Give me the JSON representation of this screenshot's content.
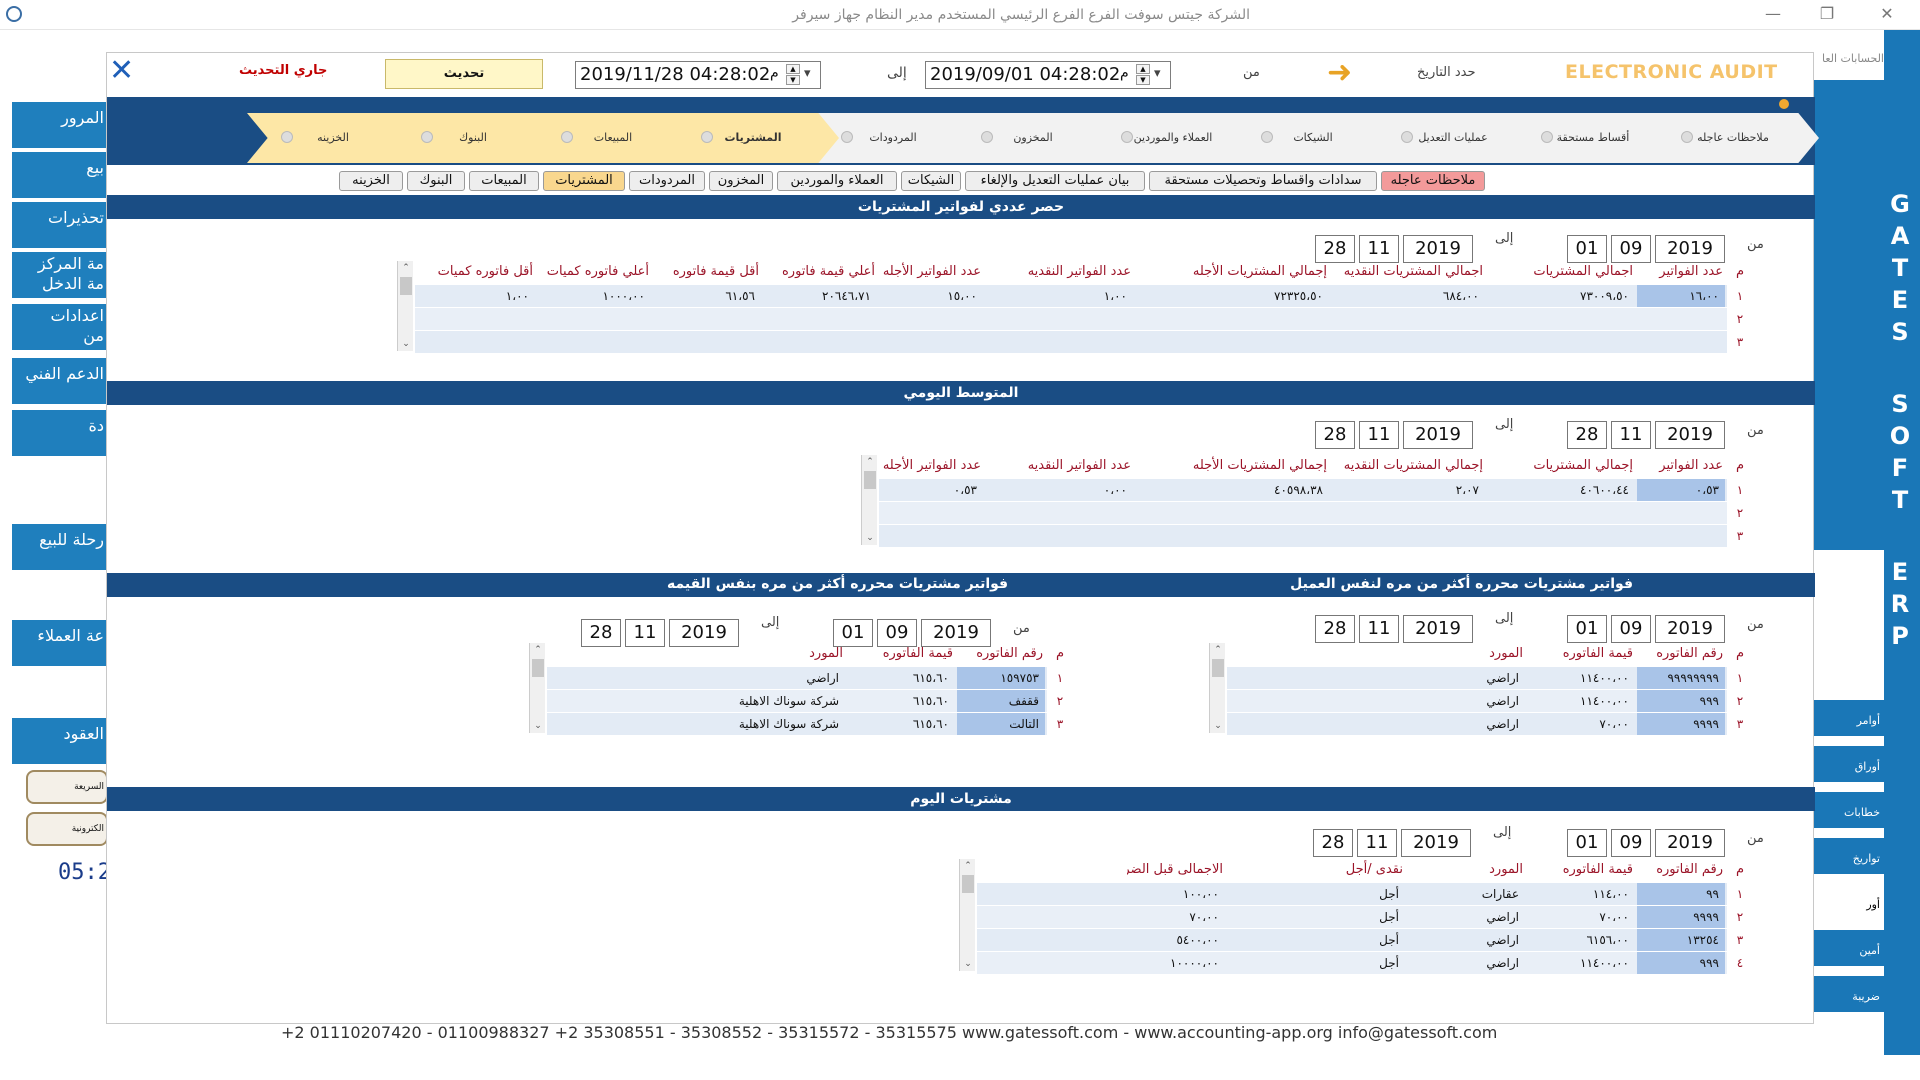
{
  "window": {
    "title": "الشركة جيتس سوفت   الفرع الفرع الرئيسي   المستخدم مدير النظام   جهاز سيرفر",
    "minimize": "—",
    "restore": "❐",
    "close": "✕"
  },
  "left_menu": [
    "المرور",
    "بيع",
    "تحذيرات",
    "مة المركز",
    "مة الدخل",
    "اعدادات",
    "من",
    "الدعم الفني",
    "دة",
    "رحلة للبيع",
    "عة العملاء",
    "العقود"
  ],
  "left_pills": [
    "السريعة",
    "الكترونية"
  ],
  "clock": "05:2",
  "right_menu": [
    "الحسابات العا",
    "أوامر",
    "أوراق",
    "خطابات",
    "تواريخ",
    "أور",
    "أمين",
    "ضريبة"
  ],
  "brand_letters": [
    "G",
    "A",
    "T",
    "E",
    "S",
    "",
    "S",
    "O",
    "F",
    "T",
    "",
    "E",
    "R",
    "P"
  ],
  "footer": "+2 01110207420 - 01100988327      +2 35308551 - 35308552 - 35315572 - 35315575      www.gatessoft.com  -  www.accounting-app.org      info@gatessoft.com",
  "toolbar": {
    "brand": "ELECTRONIC AUDIT",
    "date_range_label": "حدد التاريخ",
    "from_label": "من",
    "from_value": "2019/09/01 04:28:02",
    "to_label": "إلى",
    "to_value": "2019/11/28 04:28:02",
    "am_pm": "م",
    "refresh": "تحديث",
    "status": "جاري التحديث"
  },
  "steps": [
    "ملاحظات عاجله",
    "أقساط مستحقة",
    "عمليات التعديل",
    "الشيكات",
    "العملاء والموردين",
    "المخزون",
    "المردودات",
    "المشتريات",
    "المبيعات",
    "البنوك",
    "الخزينه"
  ],
  "tabs": [
    "ملاحظات عاجله",
    "سدادات واقساط وتحصيلات مستحقة",
    "بيان عمليات التعديل والإلغاء",
    "الشيكات",
    "العملاء والموردين",
    "المخزون",
    "المردودات",
    "المشتريات",
    "المبيعات",
    "البنوك",
    "الخزينه"
  ],
  "sections": {
    "count": {
      "title": "حصر عددي لفواتير المشتريات",
      "from": {
        "label": "من",
        "day": "01",
        "month": "09",
        "year": "2019"
      },
      "to": {
        "label": "إلى",
        "day": "28",
        "month": "11",
        "year": "2019"
      },
      "headers": [
        "م",
        "عدد الفواتير",
        "اجمالي المشتريات",
        "اجمالي المشتريات النقديه",
        "إجمالي المشتريات الأجله",
        "عدد الفواتير النقديه",
        "عدد الفواتير الأجله",
        "أعلي قيمة فاتوره",
        "أقل قيمة فاتوره",
        "أعلي فاتوره كميات",
        "أقل فاتوره كميات"
      ],
      "row_nums": [
        "١",
        "٢",
        "٣"
      ],
      "rows": [
        [
          "١٦،٠٠",
          "٧٣٠٠٩،٥٠",
          "٦٨٤،٠٠",
          "٧٢٣٢٥،٥٠",
          "١،٠٠",
          "١٥،٠٠",
          "٢٠٦٤٦،٧١",
          "٦١،٥٦",
          "١٠٠٠،٠٠",
          "١،٠٠"
        ]
      ]
    },
    "daily": {
      "title": "المتوسط اليومي",
      "from": {
        "label": "من",
        "day": "28",
        "month": "11",
        "year": "2019"
      },
      "to": {
        "label": "إلى",
        "day": "28",
        "month": "11",
        "year": "2019"
      },
      "headers": [
        "م",
        "عدد الفواتير",
        "إجمالي المشتريات",
        "إجمالي المشتريات النقديه",
        "إجمالي المشتريات الأجله",
        "عدد الفواتير النقديه",
        "عدد الفواتير الأجله"
      ],
      "row_nums": [
        "١",
        "٢",
        "٣"
      ],
      "rows": [
        [
          "٠،٥٣",
          "٤٠٦٠٠،٤٤",
          "٢،٠٧",
          "٤٠٥٩٨،٣٨",
          "٠،٠٠",
          "٠،٥٣"
        ]
      ]
    },
    "same_client": {
      "title": "فواتير مشتريات محرره أكثر من مره لنفس العميل",
      "from": {
        "label": "من",
        "day": "01",
        "month": "09",
        "year": "2019"
      },
      "to": {
        "label": "إلى",
        "day": "28",
        "month": "11",
        "year": "2019"
      },
      "headers": [
        "م",
        "رقم الفاتوره",
        "قيمة الفاتوره",
        "المورد"
      ],
      "row_nums": [
        "١",
        "٢",
        "٣"
      ],
      "rows": [
        [
          "٩٩٩٩٩٩٩٩",
          "١١٤٠٠،٠٠",
          "اراضي"
        ],
        [
          "٩٩٩",
          "١١٤٠٠،٠٠",
          "اراضي"
        ],
        [
          "٩٩٩٩",
          "٧٠،٠٠",
          "اراضي"
        ]
      ]
    },
    "same_value": {
      "title": "فواتير مشتريات محرره أكثر من مره بنفس القيمه",
      "from": {
        "label": "من",
        "day": "01",
        "month": "09",
        "year": "2019"
      },
      "to": {
        "label": "إلى",
        "day": "28",
        "month": "11",
        "year": "2019"
      },
      "headers": [
        "م",
        "رقم الفاتوره",
        "قيمة الفاتوره",
        "المورد"
      ],
      "row_nums": [
        "١",
        "٢",
        "٣"
      ],
      "rows": [
        [
          "١٥٩٧٥٣",
          "٦١٥،٦٠",
          "اراضي"
        ],
        [
          "ققفف",
          "٦١٥،٦٠",
          "شركة سوناك الاهلية"
        ],
        [
          "التالت",
          "٦١٥،٦٠",
          "شركة سوناك الاهلية"
        ]
      ]
    },
    "today": {
      "title": "مشتريات اليوم",
      "from": {
        "label": "من",
        "day": "01",
        "month": "09",
        "year": "2019"
      },
      "to": {
        "label": "إلى",
        "day": "28",
        "month": "11",
        "year": "2019"
      },
      "headers": [
        "م",
        "رقم الفاتوره",
        "قيمة الفاتوره",
        "المورد",
        "نقدى /أجل",
        "الاجمالى قبل الضريبة"
      ],
      "row_nums": [
        "١",
        "٢",
        "٣",
        "٤"
      ],
      "rows": [
        [
          "٩٩",
          "١١٤،٠٠",
          "عقارات",
          "أجل",
          "١٠٠،٠٠"
        ],
        [
          "٩٩٩٩",
          "٧٠،٠٠",
          "اراضي",
          "أجل",
          "٧٠،٠٠"
        ],
        [
          "١٣٢٥٤",
          "٦١٥٦،٠٠",
          "اراضي",
          "أجل",
          "٥٤٠٠،٠٠"
        ],
        [
          "٩٩٩",
          "١١٤٠٠،٠٠",
          "اراضي",
          "أجل",
          "١٠٠٠٠،٠٠"
        ]
      ]
    }
  }
}
